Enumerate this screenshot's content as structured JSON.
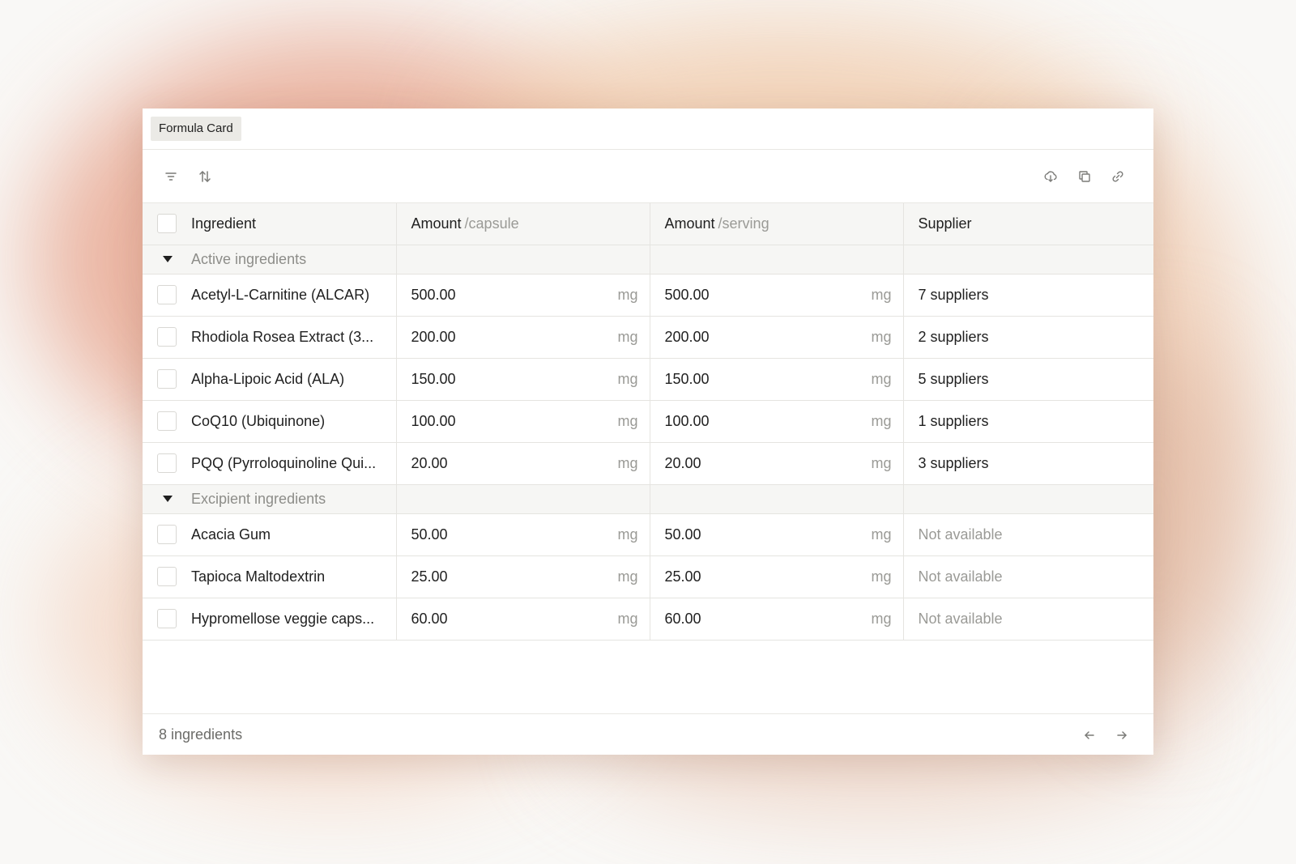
{
  "card": {
    "title": "Formula Card"
  },
  "toolbar": {
    "filter_icon": "filter-icon",
    "sort_icon": "sort-icon",
    "download_icon": "cloud-download-icon",
    "copy_icon": "copy-icon",
    "link_icon": "link-icon"
  },
  "table": {
    "headers": {
      "ingredient": "Ingredient",
      "amount_capsule": "Amount",
      "amount_capsule_sub": "/capsule",
      "amount_serving": "Amount",
      "amount_serving_sub": "/serving",
      "supplier": "Supplier"
    },
    "groups": [
      {
        "label": "Active ingredients",
        "rows": [
          {
            "name": "Acetyl-L-Carnitine (ALCAR)",
            "capsule": "500.00",
            "capsule_unit": "mg",
            "serving": "500.00",
            "serving_unit": "mg",
            "supplier": "7 suppliers"
          },
          {
            "name": "Rhodiola Rosea Extract (3...",
            "capsule": "200.00",
            "capsule_unit": "mg",
            "serving": "200.00",
            "serving_unit": "mg",
            "supplier": "2 suppliers"
          },
          {
            "name": "Alpha-Lipoic Acid (ALA)",
            "capsule": "150.00",
            "capsule_unit": "mg",
            "serving": "150.00",
            "serving_unit": "mg",
            "supplier": "5 suppliers"
          },
          {
            "name": "CoQ10 (Ubiquinone)",
            "capsule": "100.00",
            "capsule_unit": "mg",
            "serving": "100.00",
            "serving_unit": "mg",
            "supplier": "1 suppliers"
          },
          {
            "name": "PQQ (Pyrroloquinoline Qui...",
            "capsule": "20.00",
            "capsule_unit": "mg",
            "serving": "20.00",
            "serving_unit": "mg",
            "supplier": "3 suppliers"
          }
        ]
      },
      {
        "label": "Excipient ingredients",
        "rows": [
          {
            "name": "Acacia Gum",
            "capsule": "50.00",
            "capsule_unit": "mg",
            "serving": "50.00",
            "serving_unit": "mg",
            "supplier": "Not available"
          },
          {
            "name": "Tapioca Maltodextrin",
            "capsule": "25.00",
            "capsule_unit": "mg",
            "serving": "25.00",
            "serving_unit": "mg",
            "supplier": "Not available"
          },
          {
            "name": "Hypromellose veggie caps...",
            "capsule": "60.00",
            "capsule_unit": "mg",
            "serving": "60.00",
            "serving_unit": "mg",
            "supplier": "Not available"
          }
        ]
      }
    ]
  },
  "footer": {
    "count": "8 ingredients",
    "prev_icon": "arrow-left-icon",
    "next_icon": "arrow-right-icon"
  }
}
